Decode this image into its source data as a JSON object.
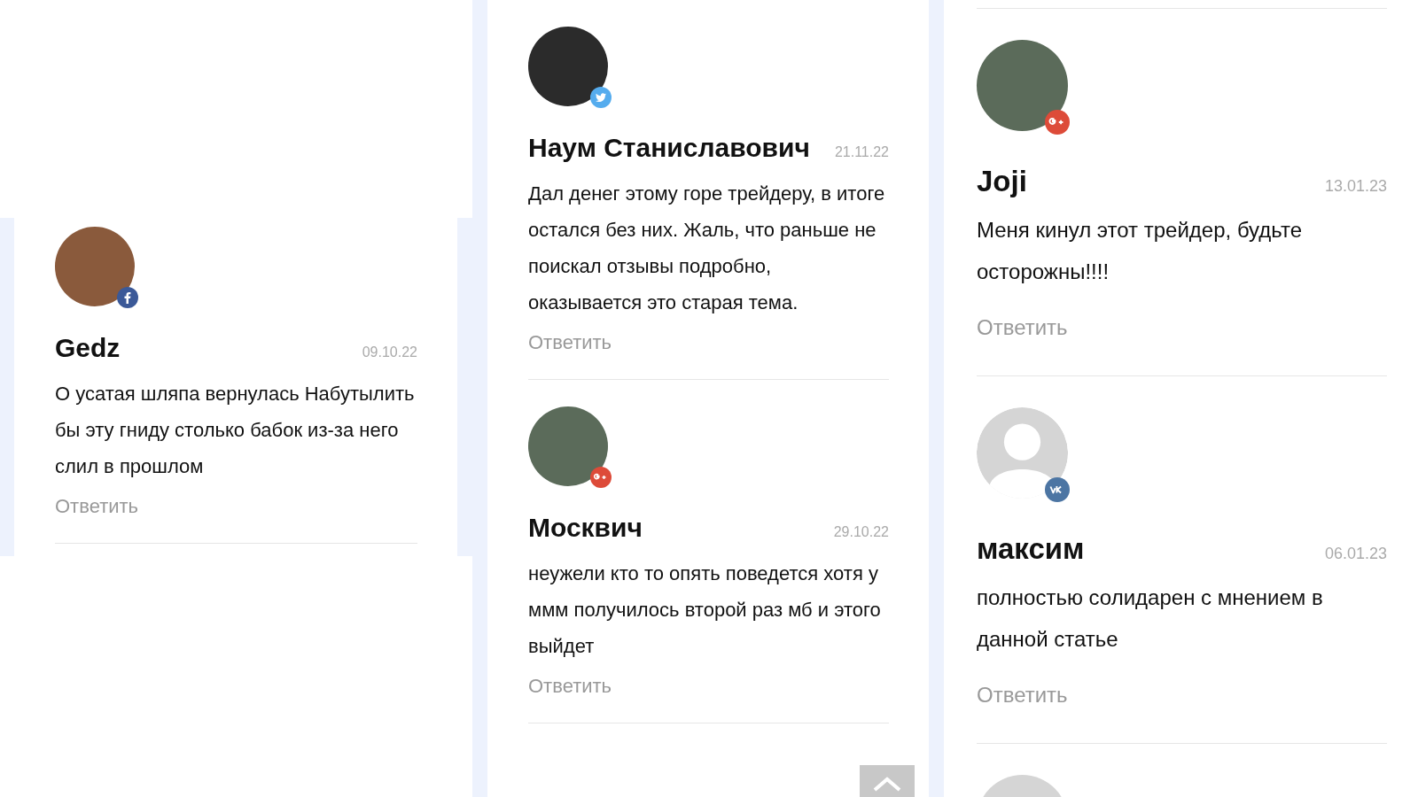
{
  "columns": [
    {
      "comments": [
        {
          "avatar": {
            "kind": "photo"
          },
          "badge": {
            "kind": "facebook"
          },
          "name": "Gedz",
          "date": "09.10.22",
          "text": "О усатая шляпа вернулась Набутылить бы эту гниду столько бабок из-за него слил в прошлом",
          "reply": "Ответить"
        }
      ]
    },
    {
      "comments": [
        {
          "avatar": {
            "kind": "photo"
          },
          "badge": {
            "kind": "twitter"
          },
          "name": "Наум Станиславович",
          "date": "21.11.22",
          "text": "Дал денег этому горе трейдеру, в итоге остался без них. Жаль, что раньше не поискал отзывы подробно, оказывается это старая тема.",
          "reply": "Ответить"
        },
        {
          "avatar": {
            "kind": "photo"
          },
          "badge": {
            "kind": "google"
          },
          "name": "Москвич",
          "date": "29.10.22",
          "text": "неужели кто то опять поведется хотя у ммм получилось второй раз мб и этого выйдет",
          "reply": "Ответить"
        }
      ]
    },
    {
      "comments": [
        {
          "avatar": {
            "kind": "photo"
          },
          "badge": {
            "kind": "google"
          },
          "name": "Joji",
          "date": "13.01.23",
          "text": "Меня кинул этот трейдер, будьте осторожны!!!!",
          "reply": "Ответить"
        },
        {
          "avatar": {
            "kind": "default"
          },
          "badge": {
            "kind": "vk"
          },
          "name": "максим",
          "date": "06.01.23",
          "text": "полностью солидарен с мнением в данной статье",
          "reply": "Ответить"
        }
      ],
      "more_below": true
    }
  ]
}
